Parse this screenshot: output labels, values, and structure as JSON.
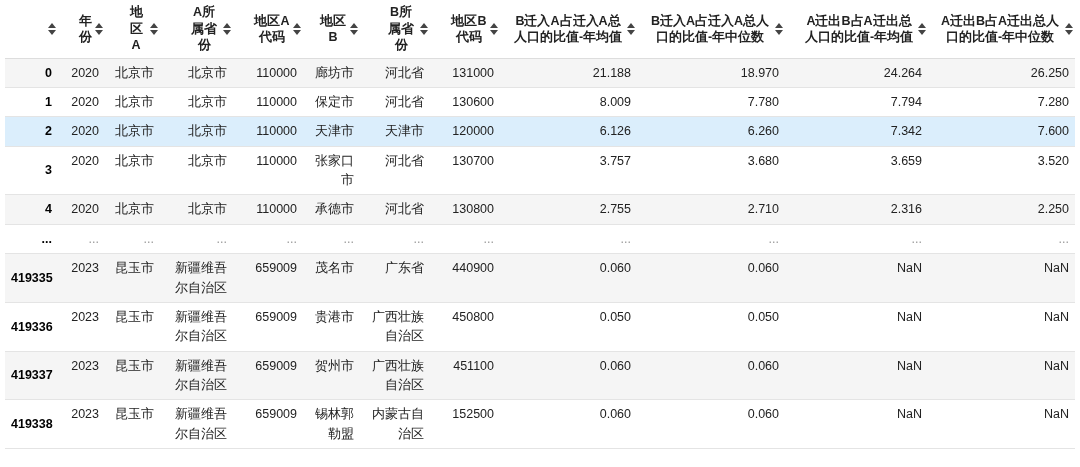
{
  "table": {
    "columns": [
      {
        "label": "年份"
      },
      {
        "label": "地区A"
      },
      {
        "label": "A所属省份"
      },
      {
        "label": "地区A代码"
      },
      {
        "label": "地区B"
      },
      {
        "label": "B所属省份"
      },
      {
        "label": "地区B代码"
      },
      {
        "label": "B迁入A占迁入A总人口的比值-年均值"
      },
      {
        "label": "B迁入A占迁入A总人口的比值-年中位数"
      },
      {
        "label": "A迁出B占A迁出总人口的比值-年均值"
      },
      {
        "label": "A迁出B占A迁出总人口的比值-年中位数"
      }
    ],
    "rows": [
      {
        "kind": "data",
        "index": "0",
        "selected": false,
        "cells": [
          "2020",
          "北京市",
          "北京市",
          "110000",
          "廊坊市",
          "河北省",
          "131000",
          "21.188",
          "18.970",
          "24.264",
          "26.250"
        ]
      },
      {
        "kind": "data",
        "index": "1",
        "selected": false,
        "cells": [
          "2020",
          "北京市",
          "北京市",
          "110000",
          "保定市",
          "河北省",
          "130600",
          "8.009",
          "7.780",
          "7.794",
          "7.280"
        ]
      },
      {
        "kind": "data",
        "index": "2",
        "selected": true,
        "cells": [
          "2020",
          "北京市",
          "北京市",
          "110000",
          "天津市",
          "天津市",
          "120000",
          "6.126",
          "6.260",
          "7.342",
          "7.600"
        ]
      },
      {
        "kind": "data",
        "index": "3",
        "selected": false,
        "cells": [
          "2020",
          "北京市",
          "北京市",
          "110000",
          "张家口市",
          "河北省",
          "130700",
          "3.757",
          "3.680",
          "3.659",
          "3.520"
        ]
      },
      {
        "kind": "data",
        "index": "4",
        "selected": false,
        "cells": [
          "2020",
          "北京市",
          "北京市",
          "110000",
          "承德市",
          "河北省",
          "130800",
          "2.755",
          "2.710",
          "2.316",
          "2.250"
        ]
      },
      {
        "kind": "ellipsis",
        "index": "...",
        "selected": false,
        "cells": [
          "...",
          "...",
          "...",
          "...",
          "...",
          "...",
          "...",
          "...",
          "...",
          "...",
          "..."
        ]
      },
      {
        "kind": "data",
        "index": "419335",
        "selected": false,
        "cells": [
          "2023",
          "昆玉市",
          "新疆维吾尔自治区",
          "659009",
          "茂名市",
          "广东省",
          "440900",
          "0.060",
          "0.060",
          "NaN",
          "NaN"
        ]
      },
      {
        "kind": "data",
        "index": "419336",
        "selected": false,
        "cells": [
          "2023",
          "昆玉市",
          "新疆维吾尔自治区",
          "659009",
          "贵港市",
          "广西壮族自治区",
          "450800",
          "0.050",
          "0.050",
          "NaN",
          "NaN"
        ]
      },
      {
        "kind": "data",
        "index": "419337",
        "selected": false,
        "cells": [
          "2023",
          "昆玉市",
          "新疆维吾尔自治区",
          "659009",
          "贺州市",
          "广西壮族自治区",
          "451100",
          "0.060",
          "0.060",
          "NaN",
          "NaN"
        ]
      },
      {
        "kind": "data",
        "index": "419338",
        "selected": false,
        "cells": [
          "2023",
          "昆玉市",
          "新疆维吾尔自治区",
          "659009",
          "锡林郭勒盟",
          "内蒙古自治区",
          "152500",
          "0.060",
          "0.060",
          "NaN",
          "NaN"
        ]
      }
    ]
  }
}
